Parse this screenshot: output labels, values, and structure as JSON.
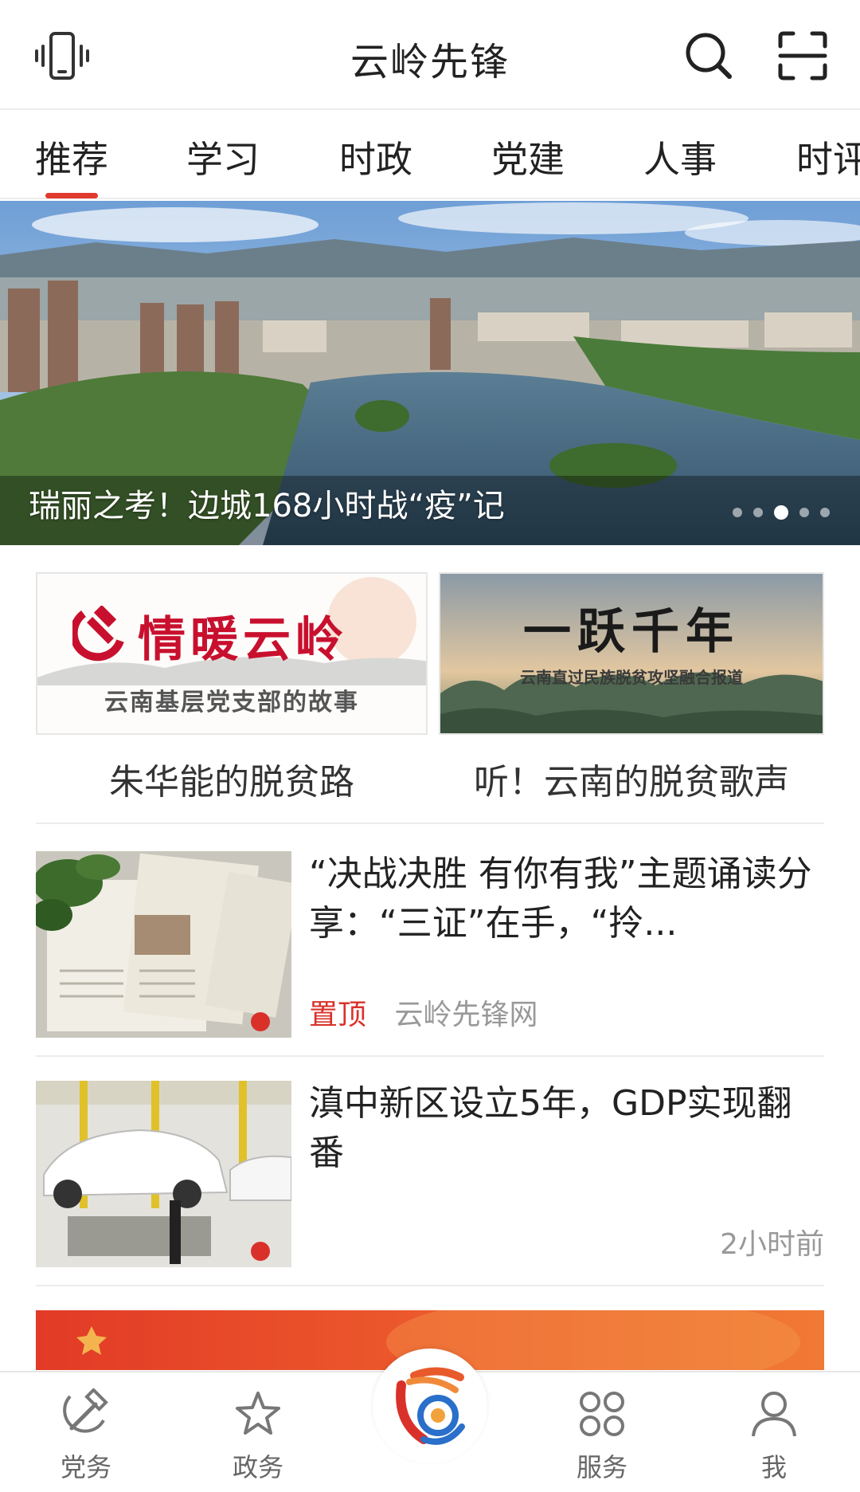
{
  "header": {
    "title": "云岭先锋",
    "left_icon": "phone-vibrate-icon",
    "search_icon": "search-icon",
    "scan_icon": "scan-icon"
  },
  "tabs": [
    {
      "label": "推荐",
      "active": true
    },
    {
      "label": "学习"
    },
    {
      "label": "时政"
    },
    {
      "label": "党建"
    },
    {
      "label": "人事"
    },
    {
      "label": "时评"
    }
  ],
  "banner": {
    "caption": "瑞丽之考！边城168小时战“疫”记",
    "dots_total": 5,
    "active_dot": 3
  },
  "features": [
    {
      "image_title": "情暖云岭",
      "image_subtitle": "云南基层党支部的故事",
      "caption": "朱华能的脱贫路"
    },
    {
      "image_title": "一跃千年",
      "image_subtitle": "云南直过民族脱贫攻坚融合报道",
      "caption": "听！云南的脱贫歌声"
    }
  ],
  "news": [
    {
      "title": "“决战决胜 有你有我”主题诵读分享：“三证”在手，“拎...",
      "tag": "置顶",
      "source": "云岭先锋网"
    },
    {
      "title": "滇中新区设立5年，GDP实现翻番",
      "time": "2小时前"
    }
  ],
  "bottom_nav": [
    {
      "label": "党务",
      "icon": "hammer-sickle-icon"
    },
    {
      "label": "政务",
      "icon": "star-icon"
    },
    {
      "label": "",
      "icon": "app-logo-icon"
    },
    {
      "label": "服务",
      "icon": "grid-services-icon"
    },
    {
      "label": "我",
      "icon": "user-icon"
    }
  ],
  "colors": {
    "accent": "#e03a2e",
    "text": "#222222",
    "muted": "#999999"
  }
}
